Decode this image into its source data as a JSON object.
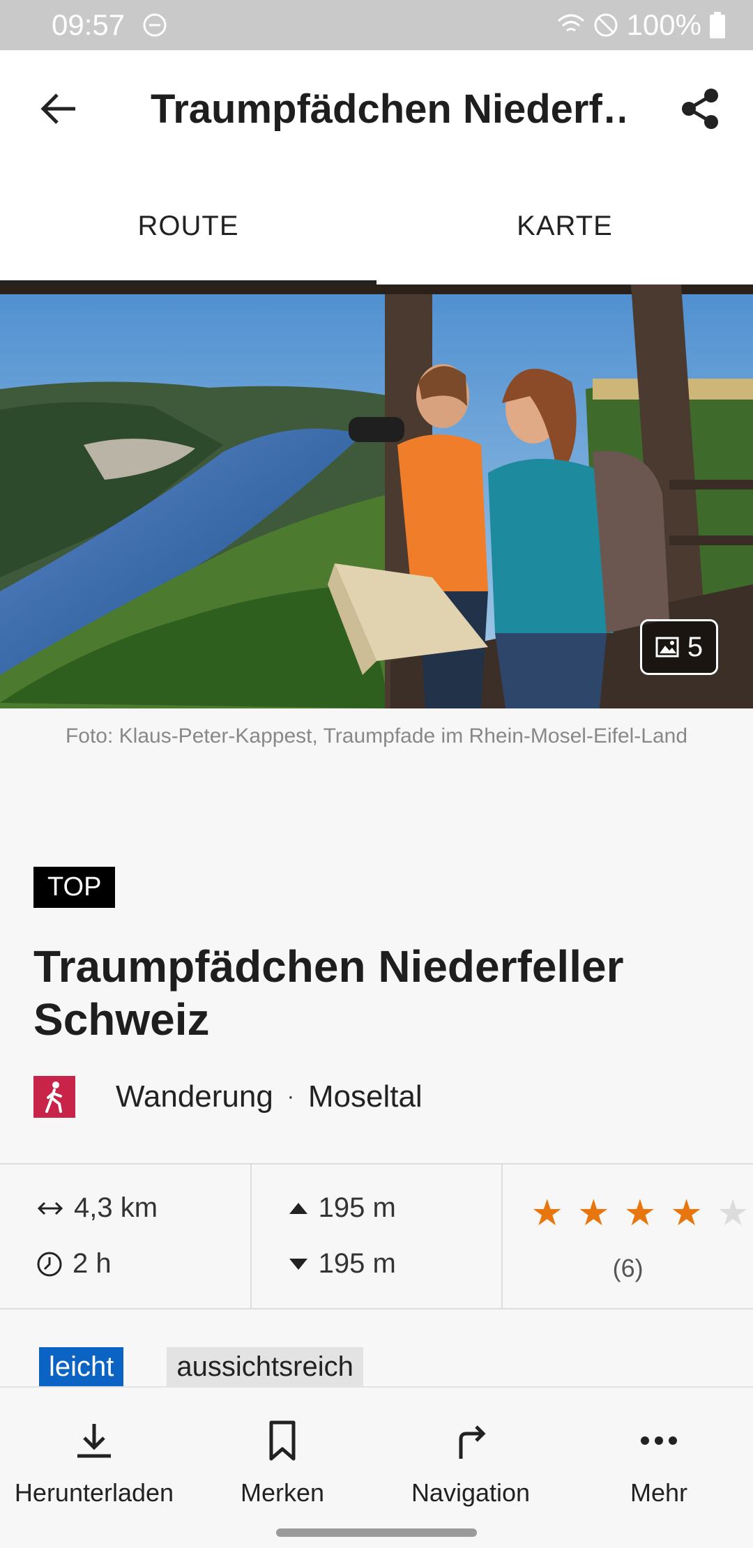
{
  "status_bar": {
    "time": "09:57",
    "battery": "100%"
  },
  "app_bar": {
    "title": "Traumpfädchen Niederf…"
  },
  "tabs": [
    {
      "label": "ROUTE"
    },
    {
      "label": "KARTE"
    }
  ],
  "hero": {
    "photo_count": "5",
    "caption": "Foto: Klaus-Peter-Kappest, Traumpfade im Rhein-Mosel-Eifel-Land"
  },
  "tour": {
    "badge": "TOP",
    "title": "Traumpfädchen Niederfeller Schweiz",
    "category": "Wanderung",
    "separator": "·",
    "region": "Moseltal"
  },
  "stats": {
    "distance": "4,3 km",
    "duration": "2 h",
    "ascent": "195 m",
    "descent": "195 m",
    "rating_value": 4,
    "rating_max": 5,
    "rating_count": "(6)"
  },
  "tags": [
    "leicht",
    "aussichtsreich"
  ],
  "bottom_nav": [
    {
      "label": "Herunterladen",
      "icon": "download-icon"
    },
    {
      "label": "Merken",
      "icon": "bookmark-icon"
    },
    {
      "label": "Navigation",
      "icon": "turn-right-icon"
    },
    {
      "label": "Mehr",
      "icon": "more-icon"
    }
  ],
  "colors": {
    "accent_hike": "#c8244a",
    "star": "#e8760f",
    "tag_easy": "#0b63c4",
    "status_bar": "#c9c9c9"
  }
}
